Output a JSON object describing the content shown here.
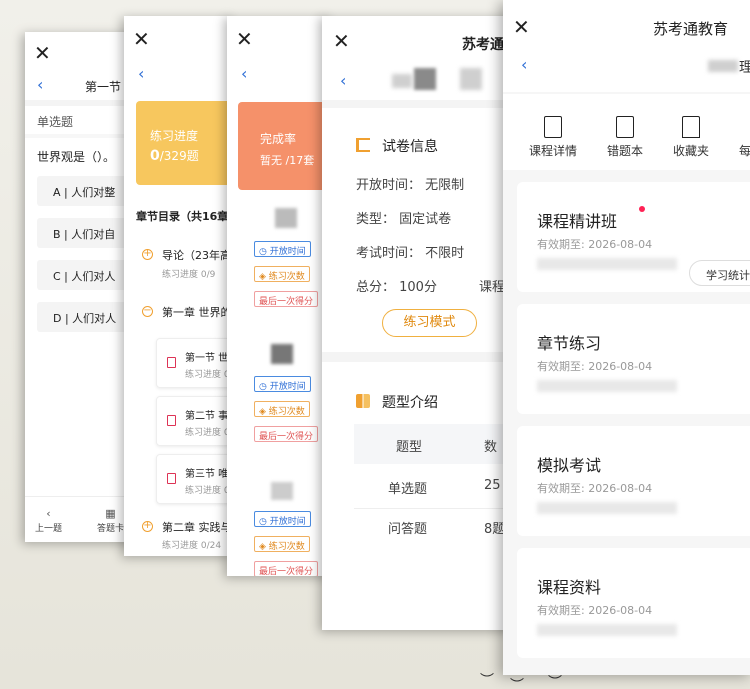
{
  "card1": {
    "title": "第一节",
    "qtype": "单选题",
    "question": "世界观是（）。",
    "options": [
      "A  |  人们对整",
      "B  |  人们对自",
      "C  |  人们对人",
      "D  |  人们对人"
    ],
    "bottom": {
      "prev": "上一题",
      "sheet": "答题卡"
    }
  },
  "card2": {
    "progress_label": "练习进度",
    "progress_done": "0",
    "progress_total": "/329题",
    "toc_title": "章节目录（共16章",
    "chapter0_title": "导论（23年高",
    "chapter0_sub": "练习进度 0/9",
    "chapter1_title": "第一章 世界的",
    "sections": [
      {
        "title": "第一节 世",
        "sub": "练习进度 0"
      },
      {
        "title": "第二节 事",
        "sub": "练习进度 0"
      },
      {
        "title": "第三节 唯",
        "sub": "练习进度 0"
      }
    ],
    "chapter2_title": "第二章 实践与",
    "chapter2_sub": "练习进度 0/24"
  },
  "card3": {
    "completion_label": "完成率",
    "completion_value": "暂无 /17套",
    "tag_open": "开放时间",
    "tag_count": "练习次数",
    "tag_last": "最后一次得分"
  },
  "card4": {
    "brand": "苏考通",
    "exam_info_title": "试卷信息",
    "open_time": "开放时间：  无限制",
    "type": "类型：  固定试卷",
    "exam_time": "考试时间：  不限时",
    "total_score": "总分：  100分",
    "course": "课程",
    "practice_button": "练习模式",
    "qtype_title": "题型介绍",
    "table": {
      "header": [
        "题型",
        "数"
      ],
      "rows": [
        [
          "单选题",
          "25"
        ],
        [
          "问答题",
          "8题"
        ]
      ]
    }
  },
  "card5": {
    "brand": "苏考通教育",
    "nav": [
      "课程详情",
      "错题本",
      "收藏夹",
      "每"
    ],
    "courses": [
      {
        "title": "课程精讲班",
        "date": "有效期至: 2026-08-04",
        "stats": "学习统计"
      },
      {
        "title": "章节练习",
        "date": "有效期至: 2026-08-04"
      },
      {
        "title": "模拟考试",
        "date": "有效期至: 2026-08-04"
      },
      {
        "title": "课程资料",
        "date": "有效期至: 2026-08-04"
      }
    ]
  },
  "icons": {
    "close": "✕",
    "back": "‹"
  }
}
